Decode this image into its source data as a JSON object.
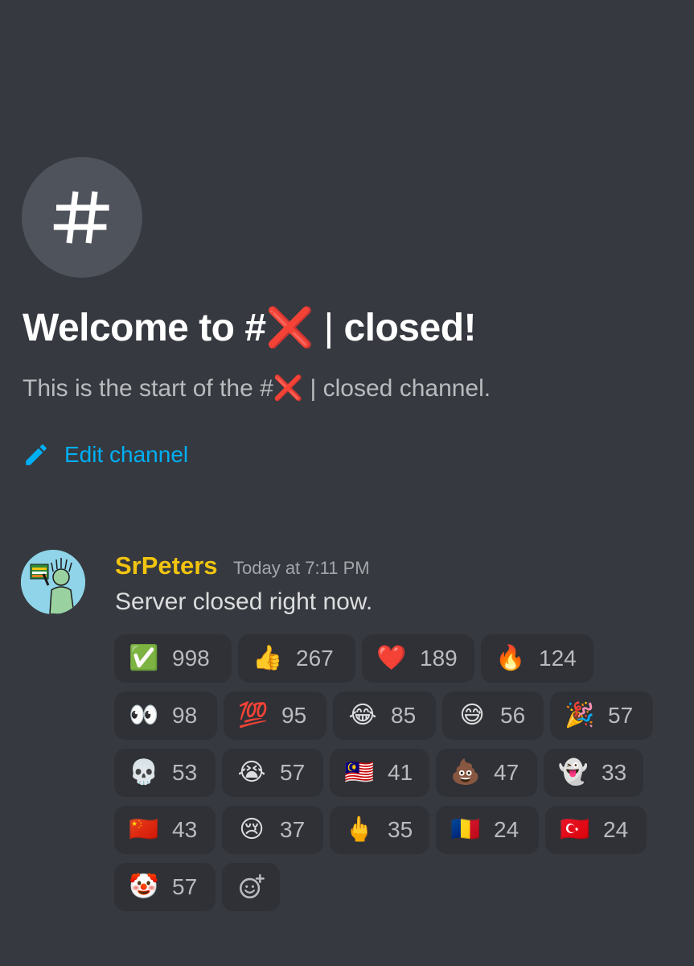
{
  "channel": {
    "title_prefix": "Welcome to #",
    "title_cross": "❌",
    "title_bar": "|",
    "title_name": "closed!",
    "sub_prefix": "This is the start of the #",
    "sub_cross": "❌",
    "sub_suffix": "| closed channel.",
    "edit_label": "Edit channel"
  },
  "message": {
    "username": "SrPeters",
    "timestamp": "Today at 7:11 PM",
    "text": "Server closed right now."
  },
  "reactions": [
    {
      "emoji": "✅",
      "icon": "check-mark-button",
      "count": "998"
    },
    {
      "emoji": "👍",
      "icon": "thumbs-up",
      "count": "267"
    },
    {
      "emoji": "❤️",
      "icon": "red-heart",
      "count": "189"
    },
    {
      "emoji": "🔥",
      "icon": "fire",
      "count": "124"
    },
    {
      "emoji": "👀",
      "icon": "eyes",
      "count": "98"
    },
    {
      "emoji": "💯",
      "icon": "hundred-points",
      "count": "95"
    },
    {
      "emoji": "😂",
      "icon": "tears-of-joy",
      "count": "85"
    },
    {
      "emoji": "😅",
      "icon": "grinning-sweat",
      "count": "56"
    },
    {
      "emoji": "🎉",
      "icon": "party-popper",
      "count": "57"
    },
    {
      "emoji": "💀",
      "icon": "skull",
      "count": "53"
    },
    {
      "emoji": "😭",
      "icon": "loudly-crying",
      "count": "57"
    },
    {
      "emoji": "🇲🇾",
      "icon": "flag-malaysia",
      "count": "41"
    },
    {
      "emoji": "💩",
      "icon": "pile-of-poo",
      "count": "47"
    },
    {
      "emoji": "👻",
      "icon": "ghost",
      "count": "33"
    },
    {
      "emoji": "🇨🇳",
      "icon": "flag-china",
      "count": "43"
    },
    {
      "emoji": "😢",
      "icon": "crying-face",
      "count": "37"
    },
    {
      "emoji": "🖕",
      "icon": "middle-finger",
      "count": "35"
    },
    {
      "emoji": "🇷🇴",
      "icon": "flag-romania",
      "count": "24"
    },
    {
      "emoji": "🇹🇷",
      "icon": "flag-turkey",
      "count": "24"
    },
    {
      "emoji": "🤡",
      "icon": "clown-face",
      "count": "57"
    }
  ],
  "colors": {
    "background": "#36393f",
    "reaction_bg": "#2f3136",
    "link": "#00aff4",
    "username": "#f1c40f",
    "cross": "#dd2e44"
  }
}
